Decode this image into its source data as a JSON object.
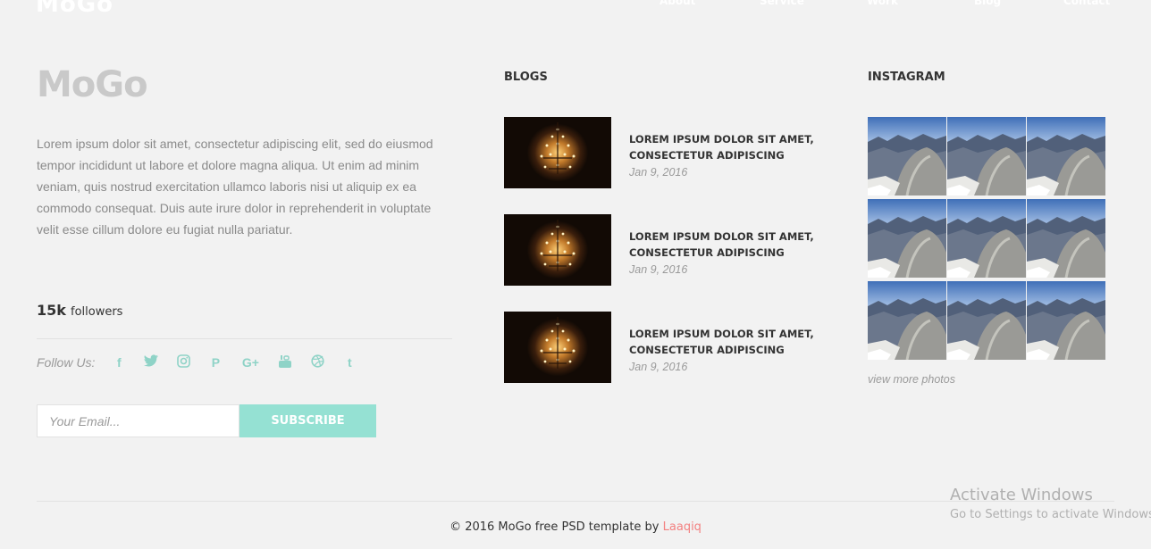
{
  "header": {
    "logo": "MoGo",
    "nav": [
      "About",
      "Service",
      "Work",
      "Blog",
      "Contact"
    ]
  },
  "about": {
    "brand": "MoGo",
    "text": "Lorem ipsum dolor sit amet, consectetur adipiscing elit, sed do eiusmod tempor incididunt ut labore et dolore magna aliqua. Ut enim ad minim veniam, quis nostrud exercitation ullamco laboris nisi ut aliquip ex ea commodo consequat. Duis aute irure dolor in reprehenderit in voluptate velit esse cillum dolore eu fugiat nulla pariatur.",
    "followers_count": "15k",
    "followers_label": "followers",
    "follow_label": "Follow Us:",
    "social_icons": [
      "facebook-icon",
      "twitter-icon",
      "instagram-icon",
      "pinterest-icon",
      "google-plus-icon",
      "youtube-icon",
      "dribbble-icon",
      "tumblr-icon"
    ],
    "social_glyphs": [
      "f",
      "t",
      "◎",
      "P",
      "G+",
      "▣",
      "⊛",
      "t"
    ],
    "email_placeholder": "Your Email...",
    "subscribe_label": "SUBSCRIBE"
  },
  "blogs": {
    "title": "BLOGS",
    "items": [
      {
        "title": "LOREM IPSUM DOLOR SIT AMET, CONSECTETUR ADIPISCING",
        "date": "Jan 9, 2016"
      },
      {
        "title": "LOREM IPSUM DOLOR SIT AMET, CONSECTETUR ADIPISCING",
        "date": "Jan 9, 2016"
      },
      {
        "title": "LOREM IPSUM DOLOR SIT AMET, CONSECTETUR ADIPISCING",
        "date": "Jan 9, 2016"
      }
    ]
  },
  "instagram": {
    "title": "INSTAGRAM",
    "view_more": "view more photos"
  },
  "footer": {
    "text": "© 2016 MoGo free PSD template by ",
    "author": "Laaqiq"
  },
  "watermark": {
    "title": "Activate Windows",
    "subtitle": "Go to Settings to activate Windows."
  },
  "colors": {
    "accent": "#95e1d3",
    "author_link": "#f38181",
    "brand_gray": "#c9c9c9"
  }
}
